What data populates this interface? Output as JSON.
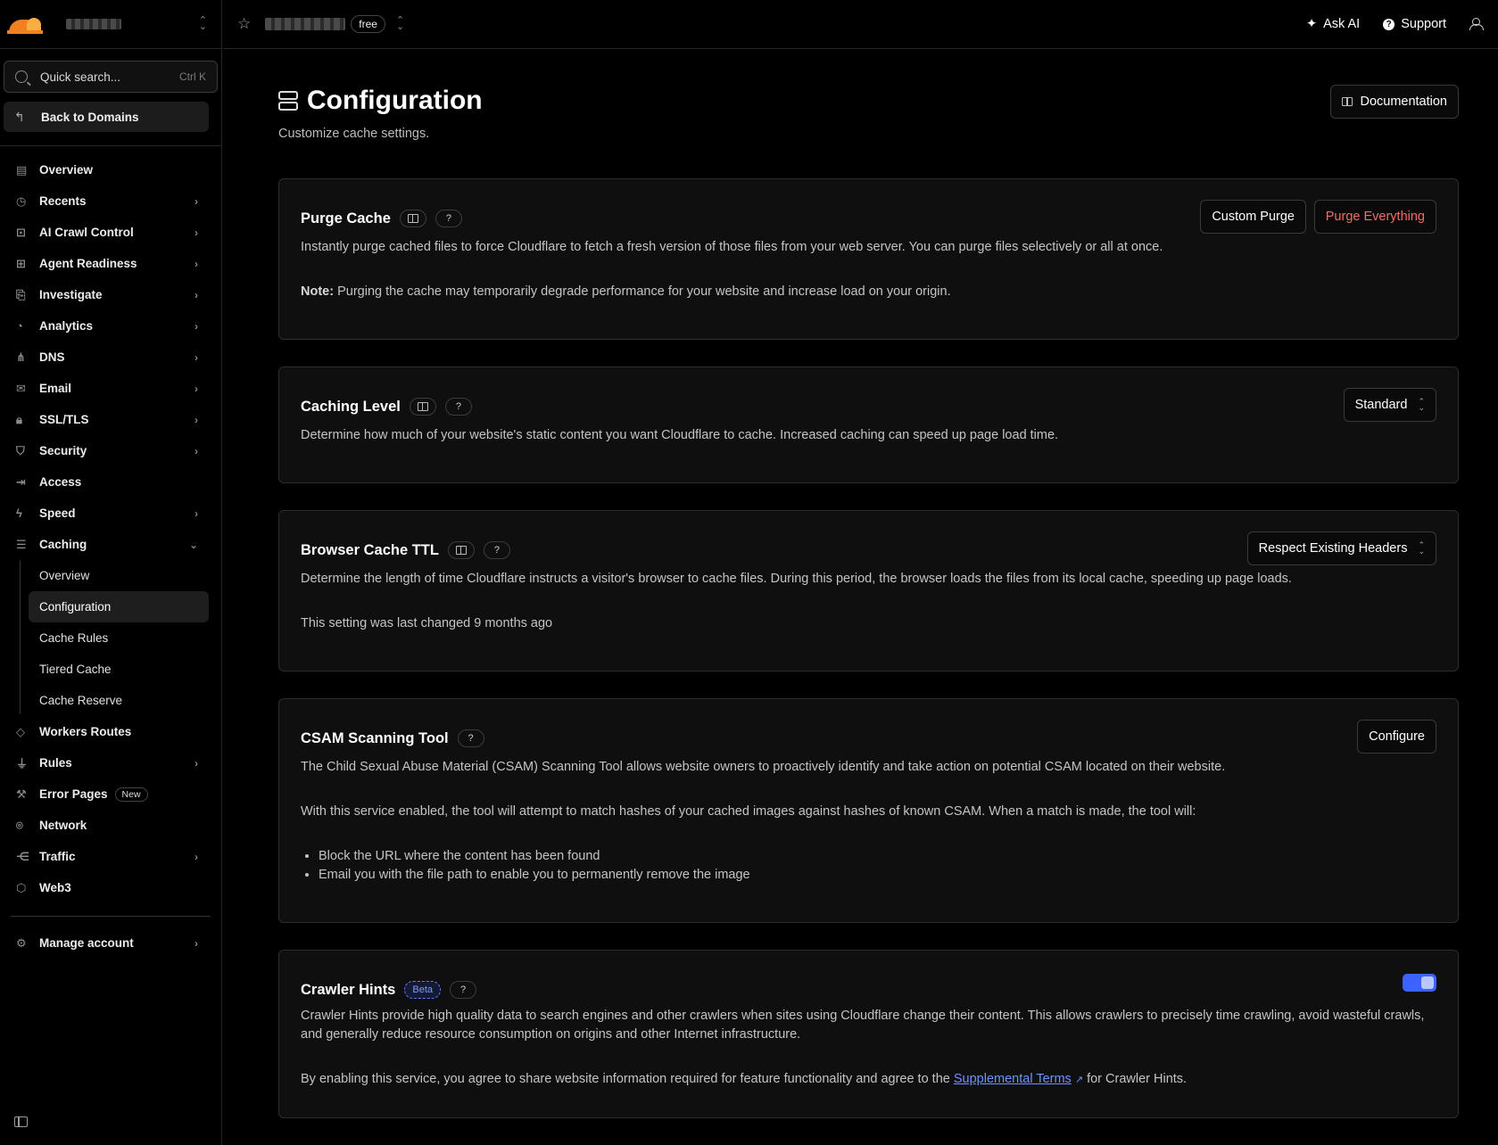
{
  "sidebar": {
    "search": {
      "label": "Quick search...",
      "shortcut": "Ctrl K"
    },
    "back_label": "Back to Domains",
    "items": [
      {
        "label": "Overview",
        "icon": "clipboard-icon",
        "chevron": false
      },
      {
        "label": "Recents",
        "icon": "history-icon",
        "chevron": true
      },
      {
        "label": "AI Crawl Control",
        "icon": "robot-icon",
        "chevron": true
      },
      {
        "label": "Agent Readiness",
        "icon": "agent-icon",
        "chevron": true
      },
      {
        "label": "Investigate",
        "icon": "investigate-icon",
        "chevron": true
      },
      {
        "label": "Analytics",
        "icon": "pie-chart-icon",
        "chevron": true
      },
      {
        "label": "DNS",
        "icon": "network-tree-icon",
        "chevron": true
      },
      {
        "label": "Email",
        "icon": "email-icon",
        "chevron": true
      },
      {
        "label": "SSL/TLS",
        "icon": "lock-icon",
        "chevron": true
      },
      {
        "label": "Security",
        "icon": "shield-icon",
        "chevron": true
      },
      {
        "label": "Access",
        "icon": "access-icon",
        "chevron": false
      },
      {
        "label": "Speed",
        "icon": "lightning-icon",
        "chevron": true
      },
      {
        "label": "Caching",
        "icon": "database-icon",
        "chevron": "down"
      }
    ],
    "caching_sub": [
      "Overview",
      "Configuration",
      "Cache Rules",
      "Tiered Cache",
      "Cache Reserve"
    ],
    "items2": [
      {
        "label": "Workers Routes",
        "icon": "workers-icon",
        "chevron": false
      },
      {
        "label": "Rules",
        "icon": "funnel-icon",
        "chevron": true
      },
      {
        "label": "Error Pages",
        "icon": "wrench-icon",
        "chevron": false,
        "badge": "New"
      },
      {
        "label": "Network",
        "icon": "location-pin-icon",
        "chevron": false
      },
      {
        "label": "Traffic",
        "icon": "traffic-icon",
        "chevron": true
      },
      {
        "label": "Web3",
        "icon": "web3-icon",
        "chevron": false
      }
    ],
    "manage_account": "Manage account"
  },
  "topbar": {
    "plan": "free",
    "ask_ai": "Ask AI",
    "support": "Support"
  },
  "page": {
    "title": "Configuration",
    "subtitle": "Customize cache settings.",
    "documentation": "Documentation"
  },
  "purge": {
    "title": "Purge Cache",
    "help": "?",
    "desc": "Instantly purge cached files to force Cloudflare to fetch a fresh version of those files from your web server. You can purge files selectively or all at once.",
    "note_label": "Note:",
    "note": " Purging the cache may temporarily degrade performance for your website and increase load on your origin.",
    "custom": "Custom Purge",
    "everything": "Purge Everything"
  },
  "caching_level": {
    "title": "Caching Level",
    "help": "?",
    "desc": "Determine how much of your website's static content you want Cloudflare to cache. Increased caching can speed up page load time.",
    "value": "Standard"
  },
  "browser_ttl": {
    "title": "Browser Cache TTL",
    "help": "?",
    "desc": "Determine the length of time Cloudflare instructs a visitor's browser to cache files. During this period, the browser loads the files from its local cache, speeding up page loads.",
    "last_changed": "This setting was last changed 9 months ago",
    "value": "Respect Existing Headers"
  },
  "csam": {
    "title": "CSAM Scanning Tool",
    "help": "?",
    "desc1": "The Child Sexual Abuse Material (CSAM) Scanning Tool allows website owners to proactively identify and take action on potential CSAM located on their website.",
    "desc2": "With this service enabled, the tool will attempt to match hashes of your cached images against hashes of known CSAM. When a match is made, the tool will:",
    "bullets": [
      "Block the URL where the content has been found",
      "Email you with the file path to enable you to permanently remove the image"
    ],
    "configure": "Configure"
  },
  "crawler": {
    "title": "Crawler Hints",
    "badge": "Beta",
    "help": "?",
    "desc1": "Crawler Hints provide high quality data to search engines and other crawlers when sites using Cloudflare change their content. This allows crawlers to precisely time crawling, avoid wasteful crawls, and generally reduce resource consumption on origins and other Internet infrastructure.",
    "desc2_pre": "By enabling this service, you agree to share website information required for feature functionality and agree to the ",
    "link": "Supplemental Terms",
    "desc2_post": " for Crawler Hints.",
    "enabled": true,
    "toggle_color": "#3c63ff"
  }
}
